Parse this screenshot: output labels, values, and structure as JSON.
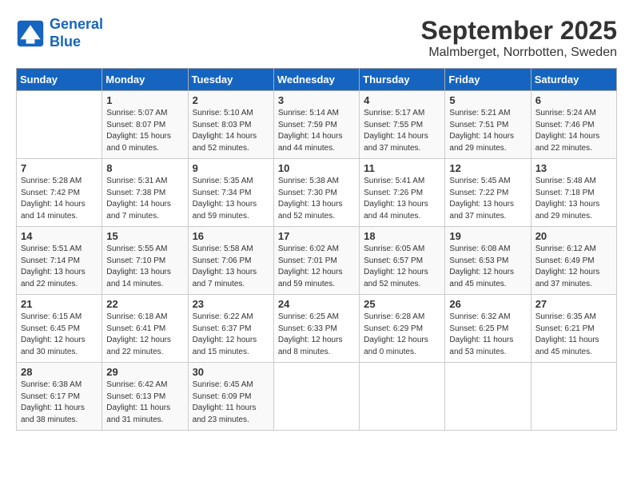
{
  "header": {
    "logo_line1": "General",
    "logo_line2": "Blue",
    "month": "September 2025",
    "location": "Malmberget, Norrbotten, Sweden"
  },
  "weekdays": [
    "Sunday",
    "Monday",
    "Tuesday",
    "Wednesday",
    "Thursday",
    "Friday",
    "Saturday"
  ],
  "weeks": [
    [
      {
        "day": "",
        "info": ""
      },
      {
        "day": "1",
        "info": "Sunrise: 5:07 AM\nSunset: 8:07 PM\nDaylight: 15 hours\nand 0 minutes."
      },
      {
        "day": "2",
        "info": "Sunrise: 5:10 AM\nSunset: 8:03 PM\nDaylight: 14 hours\nand 52 minutes."
      },
      {
        "day": "3",
        "info": "Sunrise: 5:14 AM\nSunset: 7:59 PM\nDaylight: 14 hours\nand 44 minutes."
      },
      {
        "day": "4",
        "info": "Sunrise: 5:17 AM\nSunset: 7:55 PM\nDaylight: 14 hours\nand 37 minutes."
      },
      {
        "day": "5",
        "info": "Sunrise: 5:21 AM\nSunset: 7:51 PM\nDaylight: 14 hours\nand 29 minutes."
      },
      {
        "day": "6",
        "info": "Sunrise: 5:24 AM\nSunset: 7:46 PM\nDaylight: 14 hours\nand 22 minutes."
      }
    ],
    [
      {
        "day": "7",
        "info": "Sunrise: 5:28 AM\nSunset: 7:42 PM\nDaylight: 14 hours\nand 14 minutes."
      },
      {
        "day": "8",
        "info": "Sunrise: 5:31 AM\nSunset: 7:38 PM\nDaylight: 14 hours\nand 7 minutes."
      },
      {
        "day": "9",
        "info": "Sunrise: 5:35 AM\nSunset: 7:34 PM\nDaylight: 13 hours\nand 59 minutes."
      },
      {
        "day": "10",
        "info": "Sunrise: 5:38 AM\nSunset: 7:30 PM\nDaylight: 13 hours\nand 52 minutes."
      },
      {
        "day": "11",
        "info": "Sunrise: 5:41 AM\nSunset: 7:26 PM\nDaylight: 13 hours\nand 44 minutes."
      },
      {
        "day": "12",
        "info": "Sunrise: 5:45 AM\nSunset: 7:22 PM\nDaylight: 13 hours\nand 37 minutes."
      },
      {
        "day": "13",
        "info": "Sunrise: 5:48 AM\nSunset: 7:18 PM\nDaylight: 13 hours\nand 29 minutes."
      }
    ],
    [
      {
        "day": "14",
        "info": "Sunrise: 5:51 AM\nSunset: 7:14 PM\nDaylight: 13 hours\nand 22 minutes."
      },
      {
        "day": "15",
        "info": "Sunrise: 5:55 AM\nSunset: 7:10 PM\nDaylight: 13 hours\nand 14 minutes."
      },
      {
        "day": "16",
        "info": "Sunrise: 5:58 AM\nSunset: 7:06 PM\nDaylight: 13 hours\nand 7 minutes."
      },
      {
        "day": "17",
        "info": "Sunrise: 6:02 AM\nSunset: 7:01 PM\nDaylight: 12 hours\nand 59 minutes."
      },
      {
        "day": "18",
        "info": "Sunrise: 6:05 AM\nSunset: 6:57 PM\nDaylight: 12 hours\nand 52 minutes."
      },
      {
        "day": "19",
        "info": "Sunrise: 6:08 AM\nSunset: 6:53 PM\nDaylight: 12 hours\nand 45 minutes."
      },
      {
        "day": "20",
        "info": "Sunrise: 6:12 AM\nSunset: 6:49 PM\nDaylight: 12 hours\nand 37 minutes."
      }
    ],
    [
      {
        "day": "21",
        "info": "Sunrise: 6:15 AM\nSunset: 6:45 PM\nDaylight: 12 hours\nand 30 minutes."
      },
      {
        "day": "22",
        "info": "Sunrise: 6:18 AM\nSunset: 6:41 PM\nDaylight: 12 hours\nand 22 minutes."
      },
      {
        "day": "23",
        "info": "Sunrise: 6:22 AM\nSunset: 6:37 PM\nDaylight: 12 hours\nand 15 minutes."
      },
      {
        "day": "24",
        "info": "Sunrise: 6:25 AM\nSunset: 6:33 PM\nDaylight: 12 hours\nand 8 minutes."
      },
      {
        "day": "25",
        "info": "Sunrise: 6:28 AM\nSunset: 6:29 PM\nDaylight: 12 hours\nand 0 minutes."
      },
      {
        "day": "26",
        "info": "Sunrise: 6:32 AM\nSunset: 6:25 PM\nDaylight: 11 hours\nand 53 minutes."
      },
      {
        "day": "27",
        "info": "Sunrise: 6:35 AM\nSunset: 6:21 PM\nDaylight: 11 hours\nand 45 minutes."
      }
    ],
    [
      {
        "day": "28",
        "info": "Sunrise: 6:38 AM\nSunset: 6:17 PM\nDaylight: 11 hours\nand 38 minutes."
      },
      {
        "day": "29",
        "info": "Sunrise: 6:42 AM\nSunset: 6:13 PM\nDaylight: 11 hours\nand 31 minutes."
      },
      {
        "day": "30",
        "info": "Sunrise: 6:45 AM\nSunset: 6:09 PM\nDaylight: 11 hours\nand 23 minutes."
      },
      {
        "day": "",
        "info": ""
      },
      {
        "day": "",
        "info": ""
      },
      {
        "day": "",
        "info": ""
      },
      {
        "day": "",
        "info": ""
      }
    ]
  ]
}
